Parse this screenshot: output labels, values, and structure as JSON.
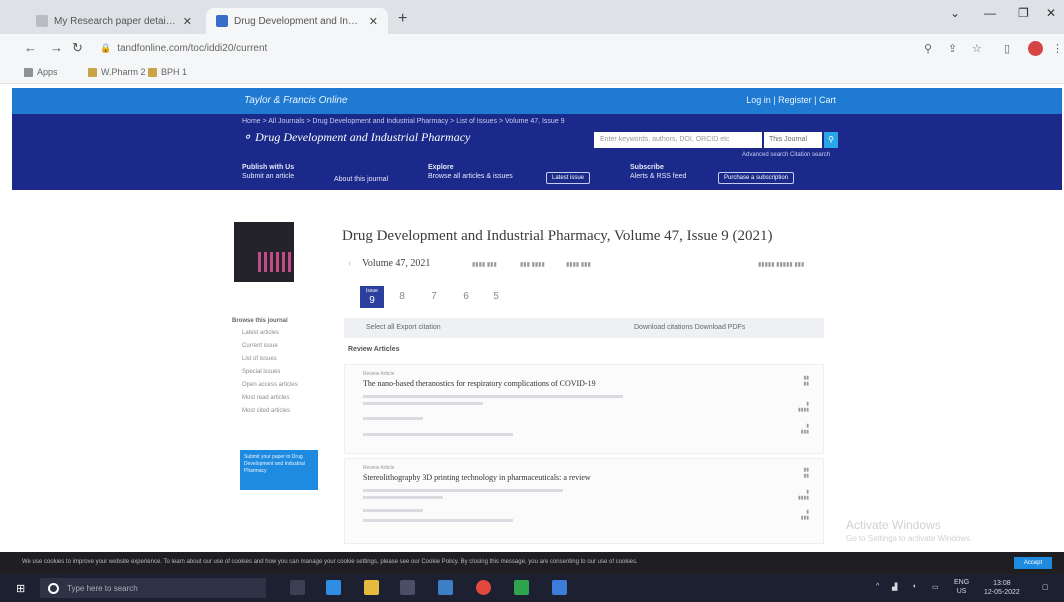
{
  "browser": {
    "tabs": [
      {
        "title": "My Research paper details - ResuR...",
        "active": false
      },
      {
        "title": "Drug Development and Industri...",
        "active": true
      }
    ],
    "url": "tandfonline.com/toc/iddi20/current",
    "bookmarks": [
      "Apps",
      "W.Pharm 2",
      "BPH 1"
    ]
  },
  "site": {
    "logo_text": "Taylor & Francis Online",
    "header_links": "Log in  |  Register  |  Cart",
    "breadcrumb": "Home  >  All Journals  >  Drug Development and Industrial Pharmacy  >  List of Issues  >  Volume 47, Issue 9",
    "journal_title": "Drug Development and Industrial Pharmacy",
    "search_placeholder": "Enter keywords, authors, DOI, ORCID etc",
    "search_scope": "This Journal",
    "advanced_search": "Advanced search   Citation search",
    "nav_columns": [
      {
        "heading": "Publish with Us",
        "link": "Submit an article"
      },
      {
        "heading": "",
        "link": "About this journal"
      },
      {
        "heading": "Explore",
        "link": "Browse all articles & issues"
      },
      {
        "heading": "Subscribe",
        "link": "Alerts & RSS feed"
      }
    ],
    "latest_issue": "Latest issue",
    "purchase": "Purchase a subscription"
  },
  "content": {
    "page_title": "Drug Development and Industrial Pharmacy, Volume 47, Issue 9 (2021)",
    "volume_label": "Volume 47, 2021",
    "issue_tabs": [
      {
        "label": "9",
        "sub": "Issue",
        "selected": true
      },
      {
        "label": "8"
      },
      {
        "label": "7"
      },
      {
        "label": "6"
      },
      {
        "label": "5"
      }
    ],
    "filter_left": "Select all   Export citation",
    "filter_right": "Download citations   Download PDFs",
    "section_heading": "Review Articles",
    "articles": [
      {
        "type": "Review Article",
        "title": "The nano-based theranostics for respiratory complications of COVID-19"
      },
      {
        "type": "Review Article",
        "title": "Stereolithography 3D printing technology in pharmaceuticals: a review"
      }
    ]
  },
  "sidebar": {
    "heading": "Browse this journal",
    "items": [
      "Latest articles",
      "Current issue",
      "List of issues",
      "Special issues",
      "Open access articles",
      "Most read articles",
      "Most cited articles"
    ],
    "promo": "Submit your paper to Drug Development and Industrial Pharmacy"
  },
  "watermark": {
    "title": "Activate Windows",
    "sub": "Go to Settings to activate Windows."
  },
  "cookie": {
    "text": "We use cookies to improve your website experience. To learn about our use of cookies and how you can manage your cookie settings, please see our Cookie Policy. By closing this message, you are consenting to our use of cookies.",
    "accept": "Accept"
  },
  "taskbar": {
    "search_placeholder": "Type here to search",
    "lang": "ENG",
    "lang2": "US",
    "time": "13:08",
    "date": "12-05-2022"
  }
}
